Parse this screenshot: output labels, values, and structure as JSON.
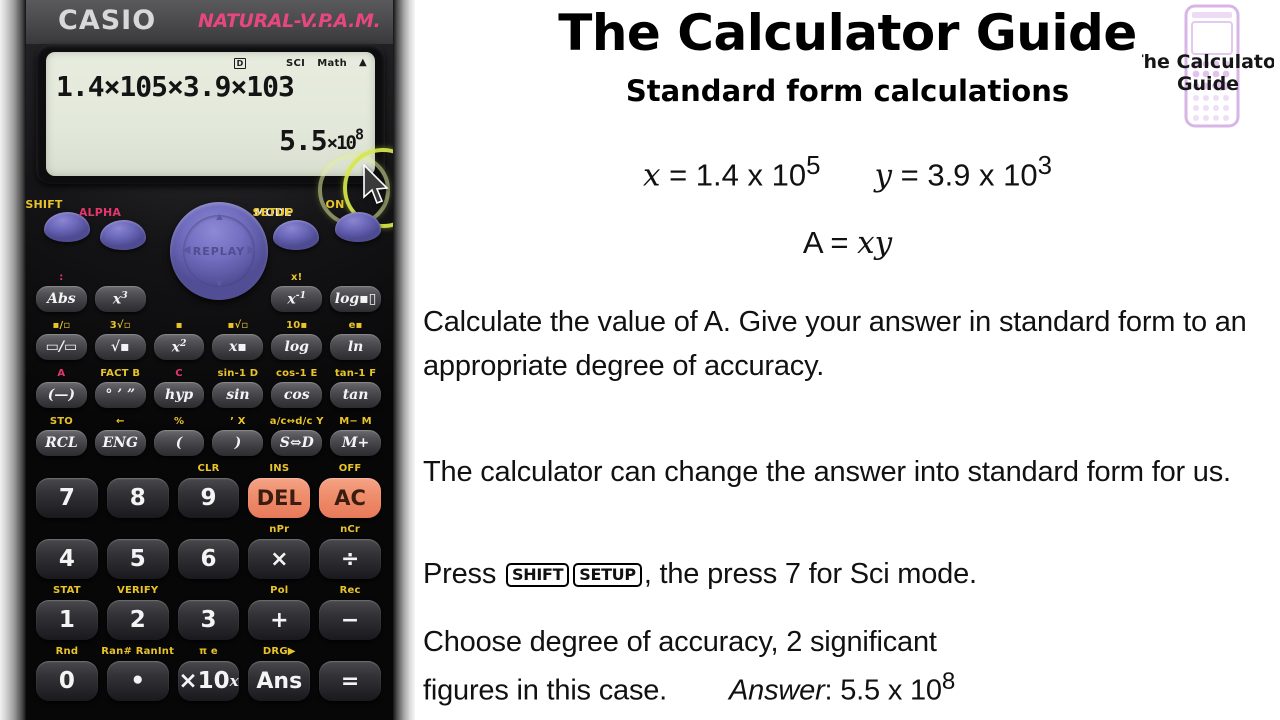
{
  "calculator": {
    "brand": "CASIO",
    "model_tag": "NATURAL-V.P.A.M.",
    "display": {
      "status_d": "D",
      "status_sci": "SCI",
      "status_math": "Math",
      "status_arrow": "▲",
      "input_line": "1.4×10",
      "input_exp1": "5",
      "input_mid": "×3.9×10",
      "input_exp2": "3",
      "result_mantissa": "5.5",
      "result_times": "×10",
      "result_exp": "8"
    },
    "controls": [
      {
        "cap": "SHIFT",
        "color": "#e8c32a"
      },
      {
        "cap": "ALPHA",
        "color": "#e4366d"
      },
      {
        "cap": "MODE",
        "color": "#f0f0f0"
      },
      {
        "cap": "SETUP",
        "color": "#e8c32a"
      },
      {
        "cap": "ON",
        "color": "#e8c32a"
      }
    ],
    "replay_label": "REPLAY",
    "rows": [
      {
        "keys": [
          {
            "sub": ":",
            "sub_color": "r",
            "label": "Abs"
          },
          {
            "sub": "",
            "sub_color": "y",
            "label": "x3"
          },
          {
            "sub": "",
            "sub_color": "y",
            "label": ""
          },
          {
            "sub": "",
            "sub_color": "y",
            "label": ""
          },
          {
            "sub": "x!",
            "sub_color": "y",
            "label": "x-1"
          },
          {
            "sub": "",
            "sub_color": "y",
            "label": "log▪▯"
          }
        ]
      },
      {
        "keys": [
          {
            "sub": "▪/▫",
            "sub_color": "y",
            "label": "▭/▭"
          },
          {
            "sub": "3√▫",
            "sub_color": "y",
            "label": "√▪"
          },
          {
            "sub": "▪",
            "sub_color": "y",
            "label": "x2"
          },
          {
            "sub": "▪√▫",
            "sub_color": "y",
            "label": "x▪"
          },
          {
            "sub": "10▪",
            "sub_color": "y",
            "label": "log"
          },
          {
            "sub": "e▪",
            "sub_color": "y",
            "label": "ln"
          }
        ]
      },
      {
        "keys": [
          {
            "sub": "A",
            "sub_color": "r",
            "label": "(—)"
          },
          {
            "sub": "FACT B",
            "sub_color": "y",
            "label": "° ’ ”"
          },
          {
            "sub": "C",
            "sub_color": "r",
            "label": "hyp"
          },
          {
            "sub": "sin-1 D",
            "sub_color": "y",
            "label": "sin"
          },
          {
            "sub": "cos-1 E",
            "sub_color": "y",
            "label": "cos"
          },
          {
            "sub": "tan-1 F",
            "sub_color": "y",
            "label": "tan"
          }
        ]
      },
      {
        "keys": [
          {
            "sub": "STO",
            "sub_color": "y",
            "label": "RCL"
          },
          {
            "sub": "←",
            "sub_color": "y",
            "label": "ENG"
          },
          {
            "sub": "%",
            "sub_color": "y",
            "label": "("
          },
          {
            "sub": "’  X",
            "sub_color": "y",
            "label": ")"
          },
          {
            "sub": "a/c↔d/c Y",
            "sub_color": "y",
            "label": "S⇔D"
          },
          {
            "sub": "M− M",
            "sub_color": "y",
            "label": "M+"
          }
        ]
      }
    ],
    "numpad": [
      {
        "keys": [
          {
            "sub": "",
            "label": "7",
            "type": "num"
          },
          {
            "sub": "",
            "label": "8",
            "type": "num"
          },
          {
            "sub": "CLR",
            "label": "9",
            "type": "num"
          },
          {
            "sub": "INS",
            "label": "DEL",
            "type": "del"
          },
          {
            "sub": "OFF",
            "label": "AC",
            "type": "ac"
          }
        ]
      },
      {
        "keys": [
          {
            "sub": "",
            "label": "4",
            "type": "num"
          },
          {
            "sub": "",
            "label": "5",
            "type": "num"
          },
          {
            "sub": "",
            "label": "6",
            "type": "num"
          },
          {
            "sub": "nPr",
            "label": "×",
            "type": "op"
          },
          {
            "sub": "nCr",
            "label": "÷",
            "type": "op"
          }
        ]
      },
      {
        "keys": [
          {
            "sub": "STAT",
            "label": "1",
            "type": "num"
          },
          {
            "sub": "VERIFY",
            "label": "2",
            "type": "num"
          },
          {
            "sub": "",
            "label": "3",
            "type": "num"
          },
          {
            "sub": "Pol",
            "label": "+",
            "type": "op"
          },
          {
            "sub": "Rec",
            "label": "−",
            "type": "op"
          }
        ]
      },
      {
        "keys": [
          {
            "sub": "Rnd",
            "label": "0",
            "type": "num"
          },
          {
            "sub": "Ran# RanInt",
            "label": "•",
            "type": "num"
          },
          {
            "sub": "π    e",
            "label": "×10x",
            "type": "num"
          },
          {
            "sub": "DRG▶",
            "label": "Ans",
            "type": "op"
          },
          {
            "sub": "",
            "label": "=",
            "type": "op"
          }
        ]
      }
    ]
  },
  "content": {
    "title": "The Calculator Guide",
    "subtitle": "Standard form calculations",
    "logo_line1": "The Calculator",
    "logo_line2": "Guide",
    "given": {
      "x_var": "x",
      "x_eq": " = 1.4 x 10",
      "x_exp": "5",
      "y_var": "y",
      "y_eq": " = 3.9 x 10",
      "y_exp": "3",
      "a_eq": "A = ",
      "a_vars": "xy"
    },
    "paragraph1": "Calculate the value of A. Give your answer in standard form to an appropriate degree of accuracy.",
    "paragraph2": "The calculator can change the answer into standard form for us.",
    "paragraph3_pre": "Press ",
    "paragraph3_key1": "SHIFT",
    "paragraph3_key2": "SETUP",
    "paragraph3_post": ", the press 7 for Sci mode.",
    "paragraph4_line1": "Choose degree of accuracy, 2 significant",
    "paragraph4_line2": "figures in this case.",
    "answer_label": "Answer",
    "answer_value": ": 5.5 x 10",
    "answer_exp": "8"
  },
  "colors": {
    "accent_yellow": "#e8c32a",
    "accent_red": "#e4366d",
    "key_orange": "#ef8f6d",
    "button_purple": "#6a66b8",
    "lcd_green": "#e2e8da",
    "highlight_ring": "#d7e84a",
    "logo_purple": "#c08ad8"
  }
}
